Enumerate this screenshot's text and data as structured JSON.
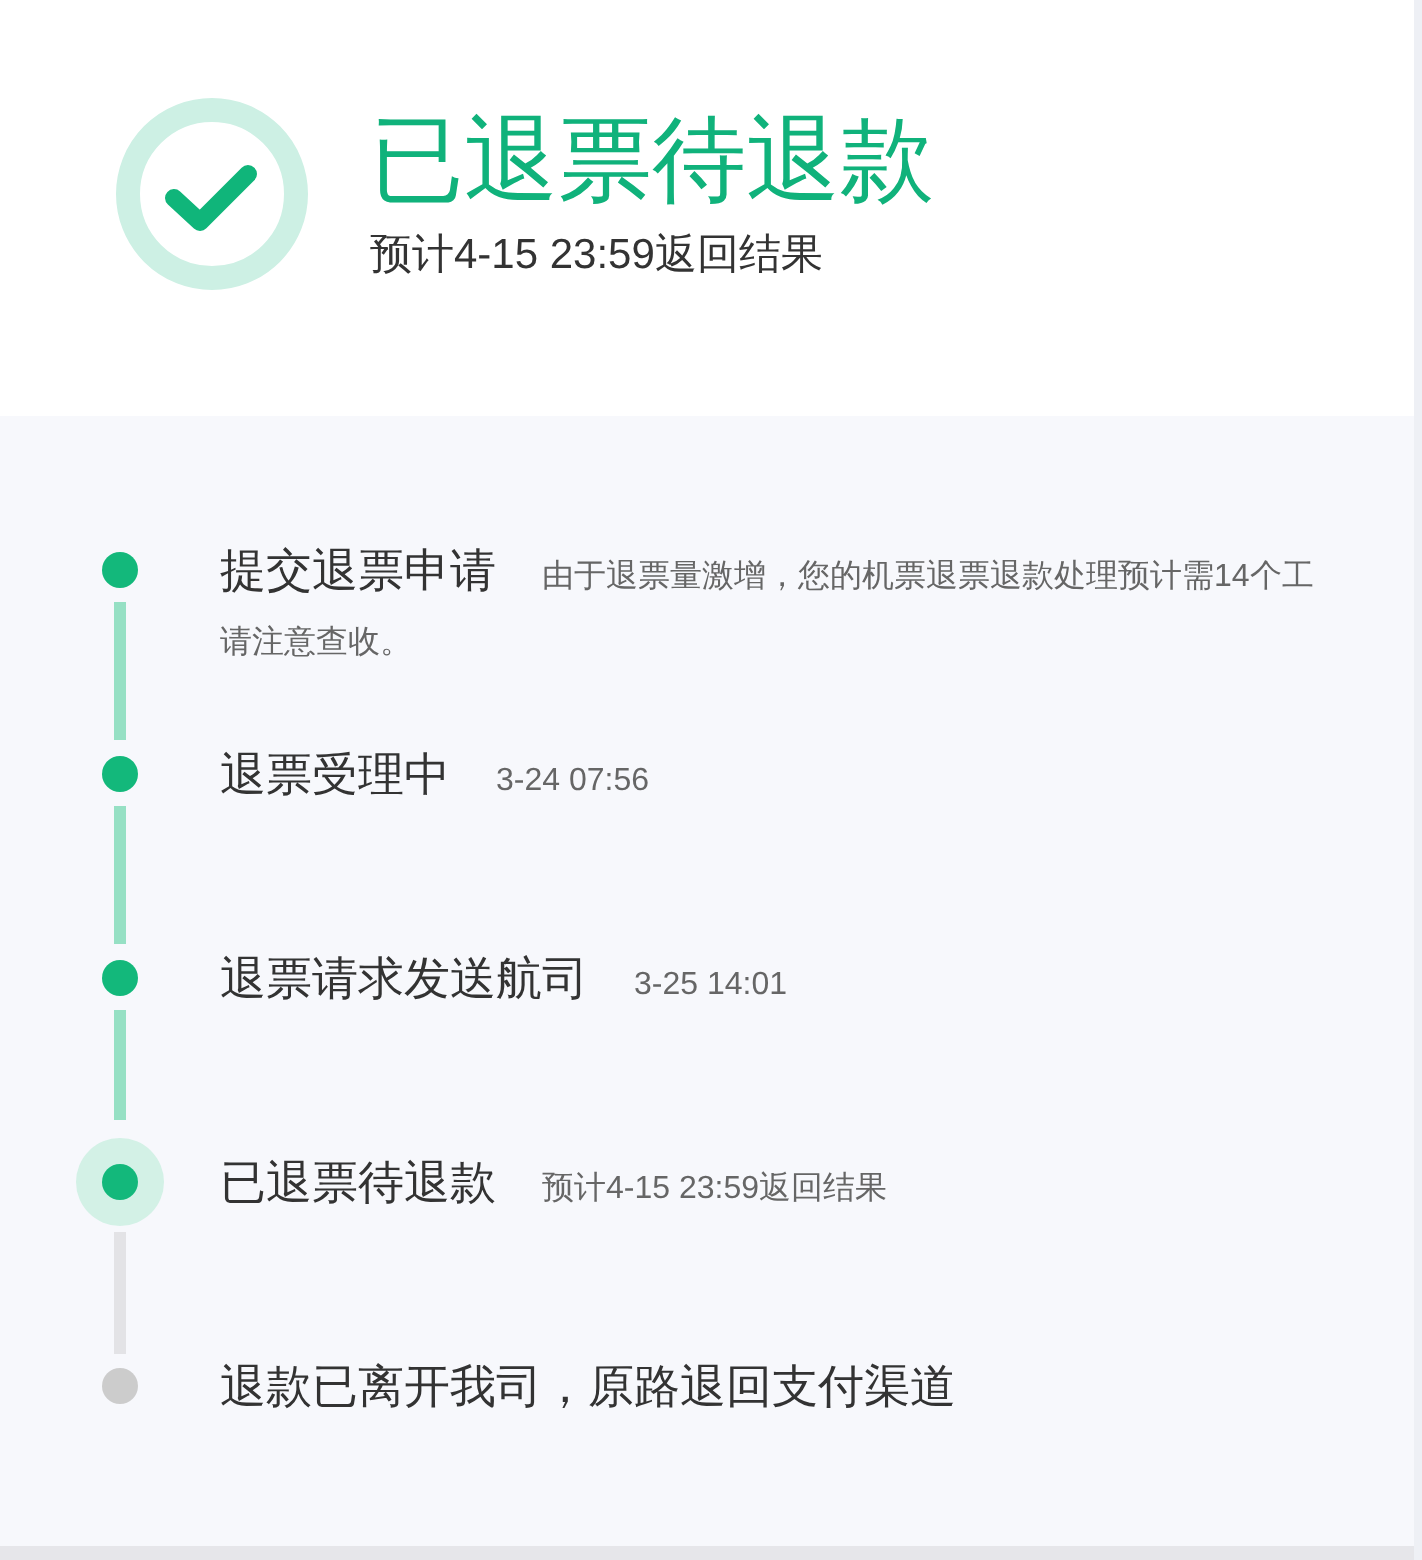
{
  "header": {
    "title": "已退票待退款",
    "subtitle": "预计4-15 23:59返回结果"
  },
  "steps": [
    {
      "title": "提交退票申请",
      "detail": "由于退票量激增，您的机票退票退款处理预计需14个工",
      "detail_continued": "请注意查收。",
      "kind": "done"
    },
    {
      "title": "退票受理中",
      "detail": "3-24 07:56",
      "kind": "done"
    },
    {
      "title": "退票请求发送航司",
      "detail": "3-25 14:01",
      "kind": "done"
    },
    {
      "title": "已退票待退款",
      "detail": "预计4-15 23:59返回结果",
      "kind": "current"
    },
    {
      "title": "退款已离开我司，原路退回支付渠道",
      "kind": "pending"
    }
  ]
}
